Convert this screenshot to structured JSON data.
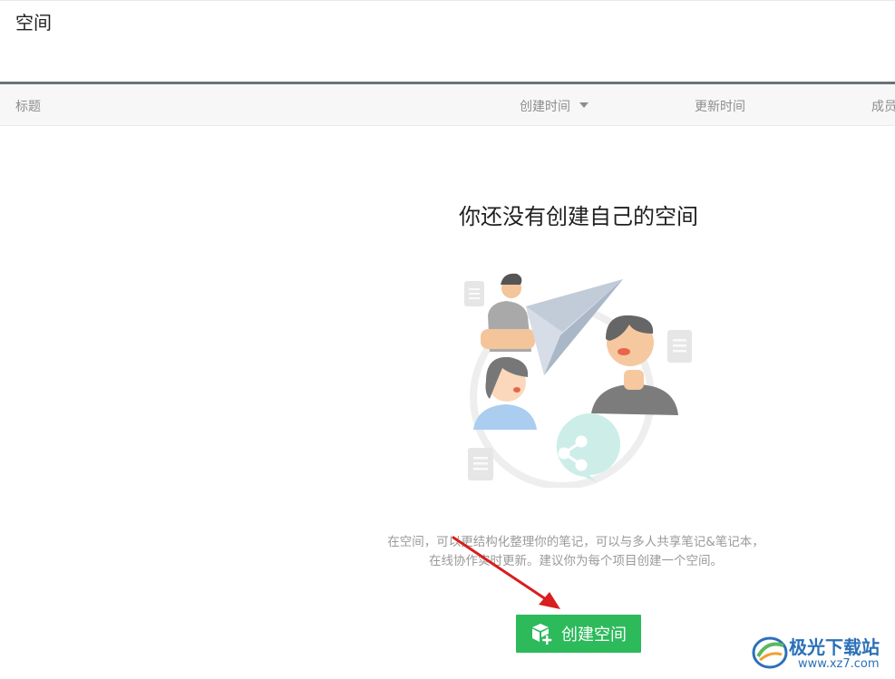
{
  "header": {
    "title": "空间"
  },
  "table": {
    "columns": [
      "标题",
      "创建时间",
      "更新时间",
      "成员"
    ],
    "sorted_column": "创建时间"
  },
  "empty_state": {
    "title": "你还没有创建自己的空间",
    "description_line1": "在空间，可以更结构化整理你的笔记，可以与多人共享笔记&笔记本，",
    "description_line2": "在线协作实时更新。建议你为每个项目创建一个空间。",
    "illustration": "people-collaboration-illustration"
  },
  "actions": {
    "create_label": "创建空间",
    "create_icon": "cube-add-icon"
  },
  "annotation": {
    "arrow_color": "#d81e1e"
  },
  "watermark": {
    "name": "极光下载站",
    "url": "www.xz7.com"
  },
  "colors": {
    "primary": "#2cba5b",
    "divider": "#68737a",
    "watermark": "#2b70b8"
  }
}
